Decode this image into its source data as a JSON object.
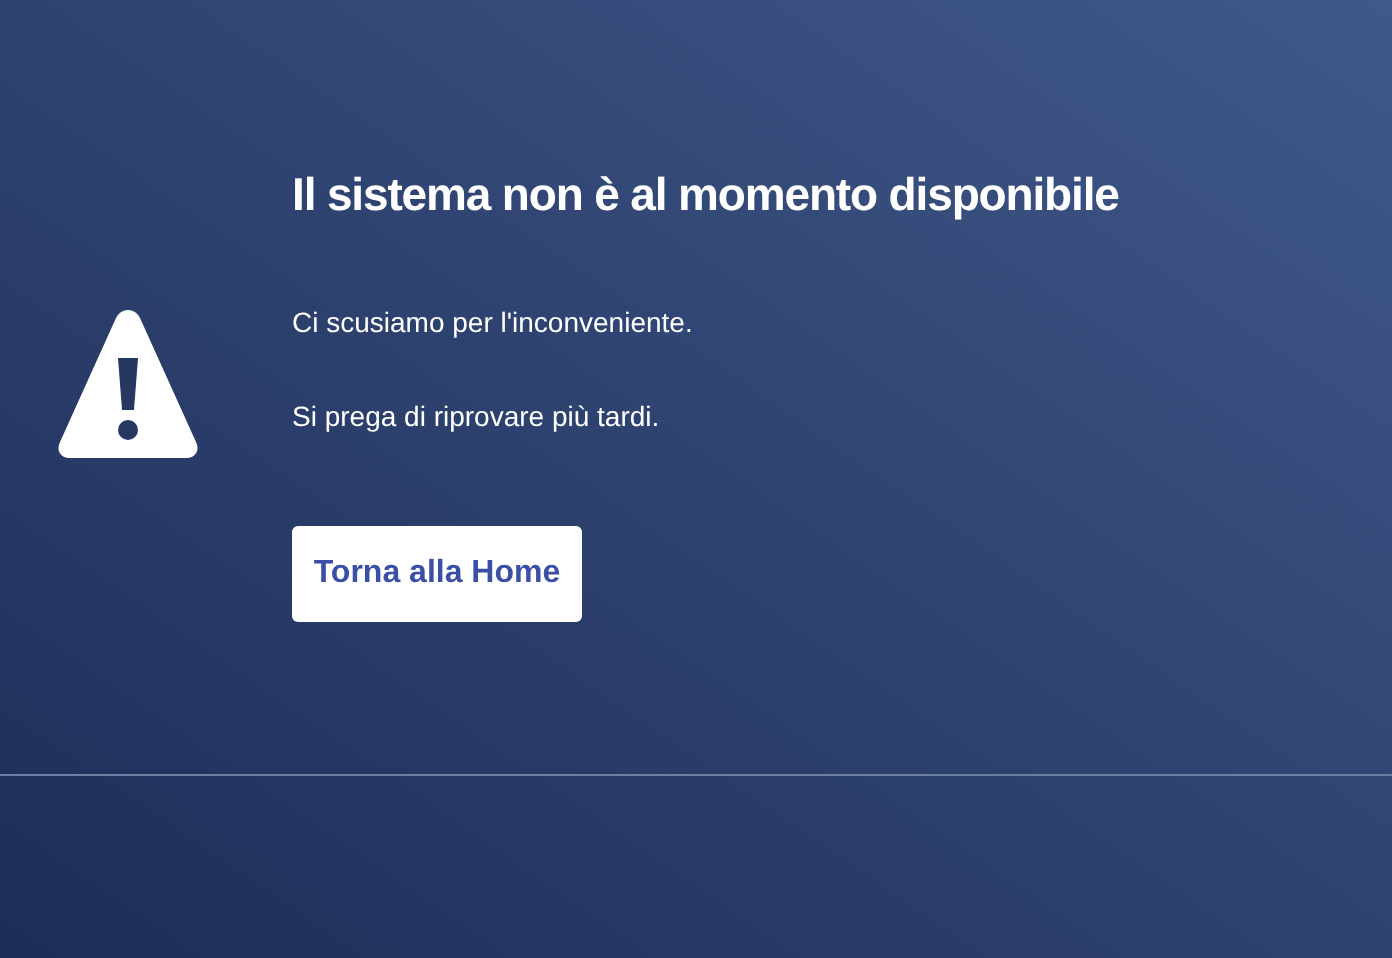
{
  "title": "Il sistema non è al momento disponibile",
  "messages": [
    "Ci scusiamo per l'inconveniente.",
    "Si prega di riprovare più tardi."
  ],
  "button": {
    "label": "Torna alla Home"
  }
}
